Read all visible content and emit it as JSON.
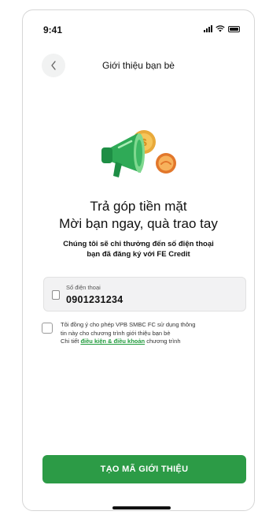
{
  "status_bar": {
    "time": "9:41"
  },
  "header": {
    "title": "Giới thiệu bạn bè"
  },
  "promo": {
    "headline_line1": "Trả góp tiền mặt",
    "headline_line2": "Mời bạn ngay, quà trao tay",
    "subtext_line1": "Chúng tôi sẽ chi thưởng đến số điện thoại",
    "subtext_line2": "bạn đã đăng ký với FE Credit"
  },
  "phone_field": {
    "label": "Số điện thoại",
    "value": "0901231234"
  },
  "consent": {
    "line1": "Tôi đồng ý cho phép VPB SMBC FC sử dụng thông",
    "line2": "tin này cho chương trình giới thiệu bạn bè",
    "details_prefix": "Chi tiết ",
    "link_text": "điều kiện & điều khoản",
    "details_suffix": " chương trình"
  },
  "cta": {
    "label": "TẠO MÃ GIỚI THIỆU"
  },
  "colors": {
    "accent": "#2c9b46",
    "link": "#1f9a3b"
  }
}
